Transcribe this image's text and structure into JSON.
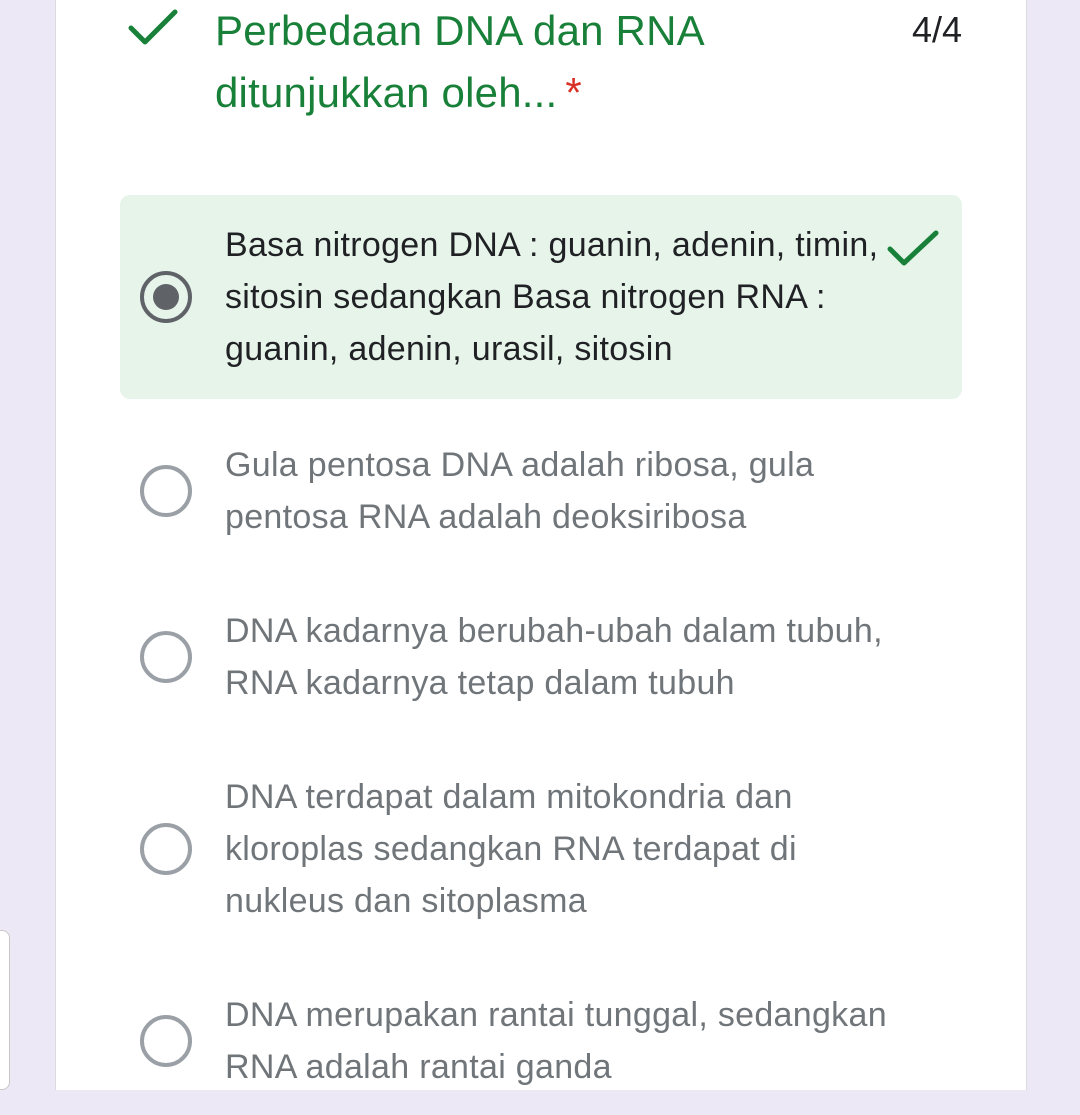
{
  "question": {
    "title": "Perbedaan DNA dan RNA ditunjukkan oleh...",
    "required_mark": "*",
    "score": "4/4",
    "status_icon": "check-icon",
    "colors": {
      "correct": "#188038",
      "required": "#d93025",
      "selected_bg": "#e6f4ea"
    }
  },
  "options": [
    {
      "label": "Basa nitrogen DNA : guanin, adenin, timin, sitosin sedangkan Basa nitrogen RNA : guanin, adenin, urasil, sitosin",
      "selected": true,
      "correct": true
    },
    {
      "label": "Gula pentosa DNA adalah ribosa, gula pentosa RNA adalah deoksiribosa",
      "selected": false
    },
    {
      "label": "DNA kadarnya berubah-ubah dalam tubuh, RNA kadarnya tetap dalam tubuh",
      "selected": false
    },
    {
      "label": "DNA terdapat dalam mitokondria dan kloroplas sedangkan RNA terdapat di nukleus dan sitoplasma",
      "selected": false
    },
    {
      "label": "DNA merupakan rantai tunggal, sedangkan RNA adalah rantai ganda",
      "selected": false
    }
  ]
}
